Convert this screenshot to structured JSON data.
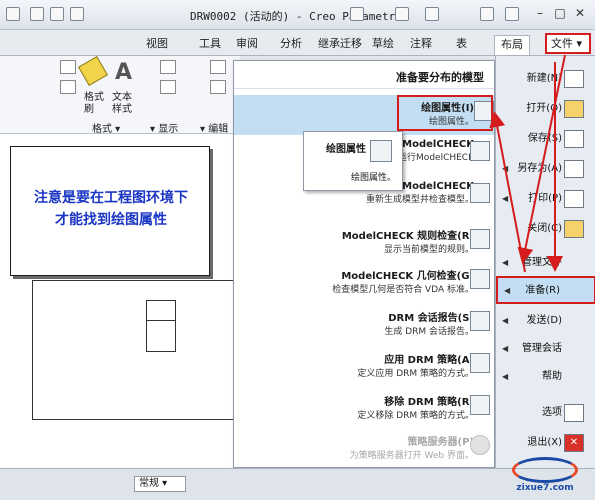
{
  "window": {
    "title": "DRW0002 (活动的) - Creo Parametric"
  },
  "tabs": [
    {
      "label": "视图"
    },
    {
      "label": "工具"
    },
    {
      "label": "审阅"
    },
    {
      "label": "分析"
    },
    {
      "label": "继承迁移"
    },
    {
      "label": "草绘"
    },
    {
      "label": "注释"
    },
    {
      "label": "表"
    },
    {
      "label": "布局"
    }
  ],
  "file_tab": {
    "label": "文件"
  },
  "ribbon": {
    "buttons": [
      {
        "label": "文本样式"
      },
      {
        "label": "格式刷"
      }
    ],
    "groups": [
      {
        "label": "格式"
      },
      {
        "label": "显示"
      },
      {
        "label": "编辑"
      }
    ]
  },
  "callout": {
    "line1": "注意是要在工程图环境下",
    "line2": "才能找到绘图属性"
  },
  "menu": {
    "header": "准备要分布的模型",
    "items": [
      {
        "title": "绘图属性(I)",
        "desc": "绘图属性。"
      },
      {
        "title": "ModelCHECK",
        "desc": "在模型上运行ModelCHECK"
      },
      {
        "title": "ModelCHECK",
        "desc": "重新生成模型并检查模型。"
      },
      {
        "title": "ModelCHECK 规则检查(R)",
        "desc": "显示当前模型的规则。"
      },
      {
        "title": "ModelCHECK 几何检查(G)",
        "desc": "检查模型几何是否符合 VDA 标准。"
      },
      {
        "title": "DRM 会话报告(S)",
        "desc": "生成 DRM 会话报告。"
      },
      {
        "title": "应用 DRM 策略(A)",
        "desc": "定义应用 DRM 策略的方式。"
      },
      {
        "title": "移除 DRM 策略(R)",
        "desc": "定义移除 DRM 策略的方式。"
      },
      {
        "title": "策略服务器(P)",
        "desc": "为策略服务器打开 Web 界面。"
      }
    ]
  },
  "submenu": {
    "title": "绘图属性",
    "desc": "绘图属性。"
  },
  "right_menu": [
    {
      "label": "新建(N)"
    },
    {
      "label": "打开(O)"
    },
    {
      "label": "保存(S)"
    },
    {
      "label": "另存为(A)"
    },
    {
      "label": "打印(P)"
    },
    {
      "label": "关闭(C)"
    },
    {
      "label": "管理文件"
    },
    {
      "label": "准备(R)"
    },
    {
      "label": "发送(D)"
    },
    {
      "label": "管理会话"
    },
    {
      "label": "帮助"
    },
    {
      "label": "选项"
    },
    {
      "label": "退出(X)"
    }
  ],
  "status": {
    "mode": "常规"
  },
  "colors": {
    "annotation_red": "#d41c1c",
    "callout_blue": "#1b36c4",
    "highlight": "#c3def3"
  },
  "logo": {
    "text": "zixue7.com"
  }
}
